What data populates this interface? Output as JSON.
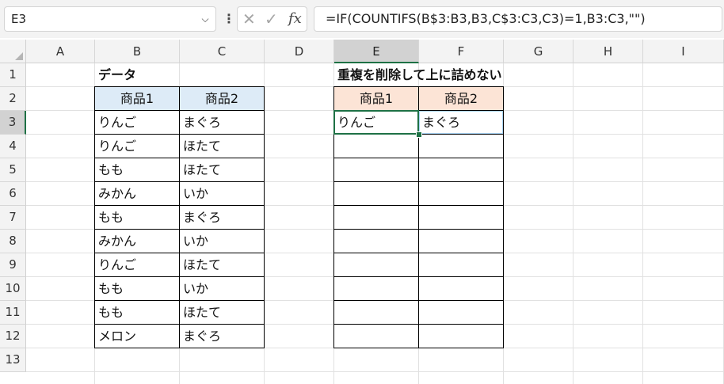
{
  "formula_bar": {
    "name_box": "E3",
    "formula": "=IF(COUNTIFS(B$3:B3,B3,C$3:C3,C3)=1,B3:C3,\"\")",
    "fx_label": "fx"
  },
  "columns": [
    "A",
    "B",
    "C",
    "D",
    "E",
    "F",
    "G",
    "H",
    "I"
  ],
  "rows": [
    "1",
    "2",
    "3",
    "4",
    "5",
    "6",
    "7",
    "8",
    "9",
    "10",
    "11",
    "12",
    "13"
  ],
  "sheet": {
    "title_left": "データ",
    "title_right": "重複を削除して上に詰めない",
    "left_headers": [
      "商品1",
      "商品2"
    ],
    "right_headers": [
      "商品1",
      "商品2"
    ],
    "left_table": [
      [
        "りんご",
        "まぐろ"
      ],
      [
        "りんご",
        "ほたて"
      ],
      [
        "もも",
        "ほたて"
      ],
      [
        "みかん",
        "いか"
      ],
      [
        "もも",
        "まぐろ"
      ],
      [
        "みかん",
        "いか"
      ],
      [
        "りんご",
        "ほたて"
      ],
      [
        "もも",
        "いか"
      ],
      [
        "もも",
        "ほたて"
      ],
      [
        "メロン",
        "まぐろ"
      ]
    ],
    "right_table": [
      [
        "りんご",
        "まぐろ"
      ],
      [
        "",
        ""
      ],
      [
        "",
        ""
      ],
      [
        "",
        ""
      ],
      [
        "",
        ""
      ],
      [
        "",
        ""
      ],
      [
        "",
        ""
      ],
      [
        "",
        ""
      ],
      [
        "",
        ""
      ],
      [
        "",
        ""
      ]
    ]
  },
  "colors": {
    "left_header_fill": "#ddebf7",
    "right_header_fill": "#fce4d6",
    "selection": "#1e7145"
  }
}
